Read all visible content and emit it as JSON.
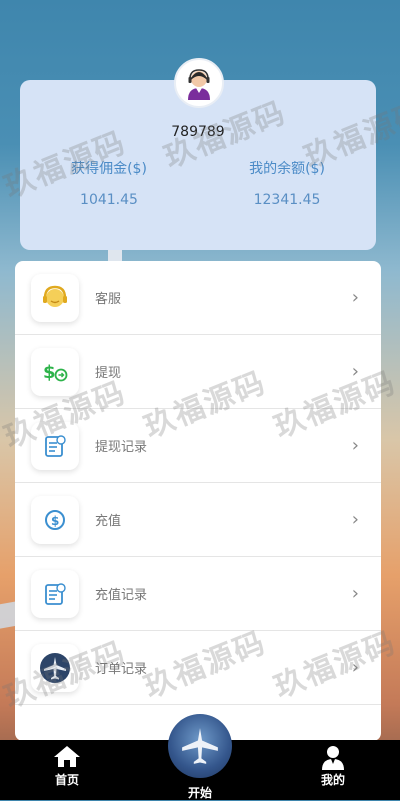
{
  "profile": {
    "username": "789789",
    "commission_label": "获得佣金($)",
    "commission_value": "1041.45",
    "balance_label": "我的余额($)",
    "balance_value": "12341.45"
  },
  "menu": {
    "items": [
      {
        "label": "客服",
        "icon": "customer-service-icon"
      },
      {
        "label": "提现",
        "icon": "withdraw-icon"
      },
      {
        "label": "提现记录",
        "icon": "withdraw-record-icon"
      },
      {
        "label": "充值",
        "icon": "recharge-icon"
      },
      {
        "label": "充值记录",
        "icon": "recharge-record-icon"
      },
      {
        "label": "订单记录",
        "icon": "order-record-icon"
      }
    ]
  },
  "tabbar": {
    "home_label": "首页",
    "start_label": "开始",
    "mine_label": "我的"
  },
  "watermark": "玖福源码",
  "colors": {
    "card_bg": "#d6e3f6",
    "stat_text": "#4b8bc7",
    "tabbar_bg": "#000000",
    "green_icon": "#2db34a",
    "blue_icon": "#3b8fd0",
    "gold_icon": "#e6b02a"
  }
}
